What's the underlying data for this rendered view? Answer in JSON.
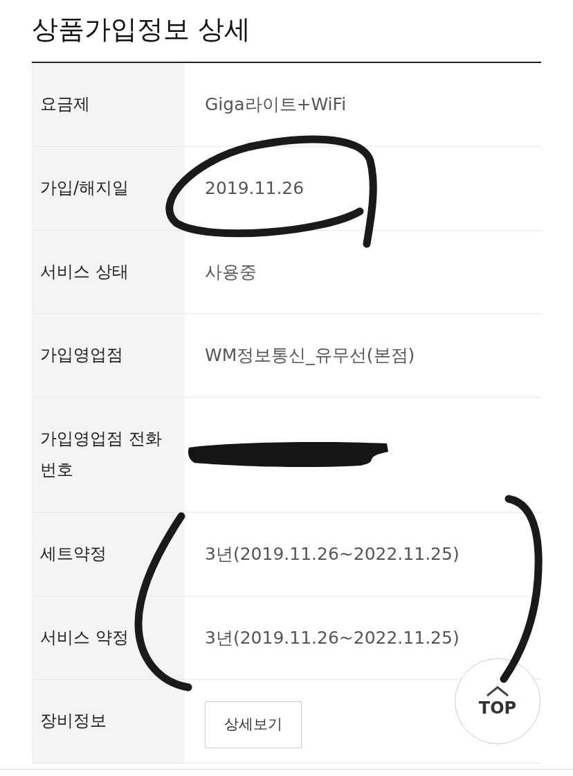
{
  "page": {
    "title": "상품가입정보 상세"
  },
  "rows": [
    {
      "label": "요금제",
      "value": "Giga라이트+WiFi"
    },
    {
      "label": "가입/해지일",
      "value": "2019.11.26"
    },
    {
      "label": "서비스 상태",
      "value": "사용중"
    },
    {
      "label": "가입영업점",
      "value": "WM정보통신_유무선(본점)"
    },
    {
      "label": "가입영업점 전화번호",
      "redacted": true
    },
    {
      "label": "세트약정",
      "value": "3년(2019.11.26~2022.11.25)"
    },
    {
      "label": "서비스 약정",
      "value": "3년(2019.11.26~2022.11.25)"
    },
    {
      "label": "장비정보",
      "button": "상세보기"
    }
  ],
  "top_button": {
    "label": "TOP"
  }
}
